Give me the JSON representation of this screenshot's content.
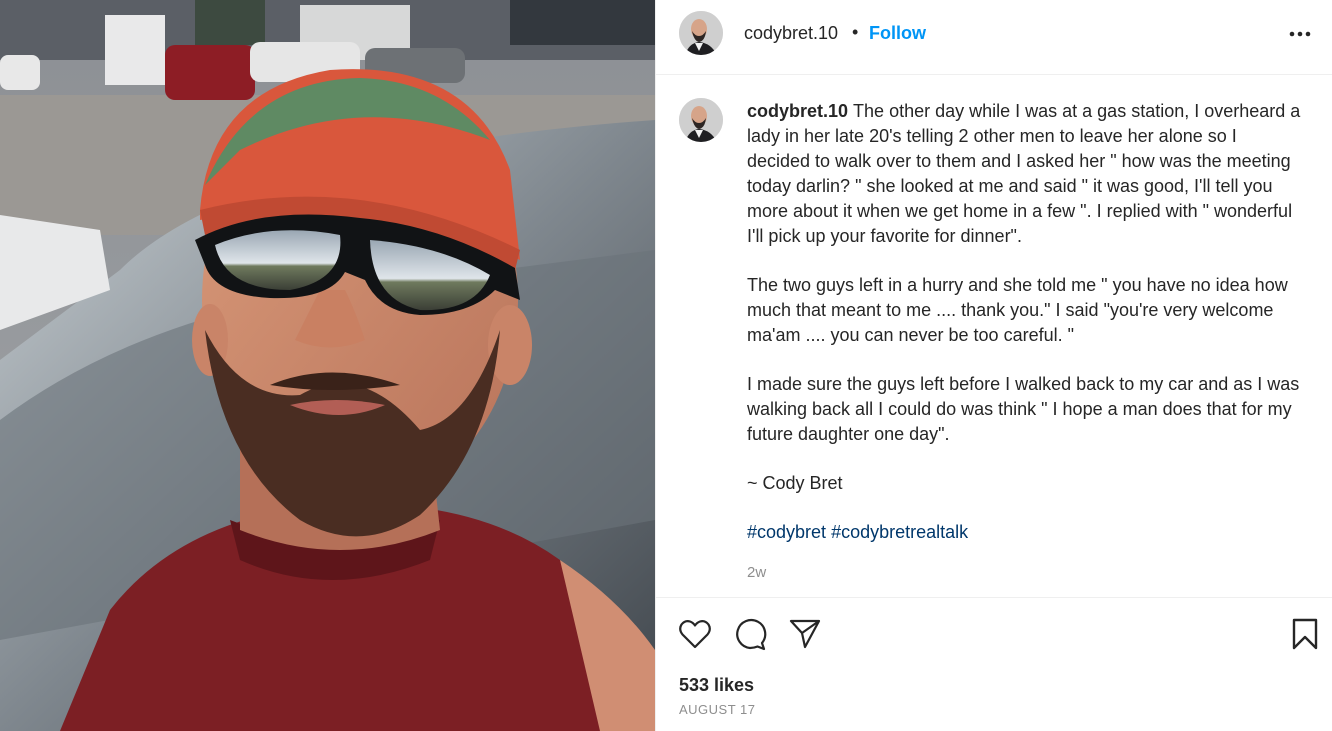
{
  "post": {
    "author": "codybret.10",
    "follow_label": "Follow",
    "separator": "•",
    "caption": {
      "username": "codybret.10",
      "paragraphs": [
        "The other day while I was at a gas station, I overheard a lady in her late 20's telling 2 other men to leave her alone so I decided to walk over to them and I asked her \" how was the meeting today darlin? \" she looked at me and said \" it was good, I'll tell you more about it when we get home in a few \". I replied with \" wonderful I'll pick up your favorite for dinner\".",
        "The two guys left in a hurry and she told me \" you have no idea how much that meant to me .... thank you.\" I said \"you're very welcome ma'am .... you can never be too careful. \"",
        "I made sure the guys left before I walked back to my car and as I was walking back all I could do was think \" I hope a man does that for my future daughter one day\".",
        "~ Cody Bret"
      ],
      "hashtags": [
        "#codybret",
        "#codybretrealtalk"
      ],
      "time": "2w"
    },
    "likes": "533 likes",
    "date": "August 17"
  },
  "icons": {
    "more": "more-options-icon",
    "like": "heart-icon",
    "comment": "comment-bubble-icon",
    "share": "paper-plane-icon",
    "save": "bookmark-icon"
  },
  "colors": {
    "accent": "#0095f6",
    "hashtag": "#00376b",
    "muted": "#8e8e8e",
    "border": "#efefef"
  }
}
